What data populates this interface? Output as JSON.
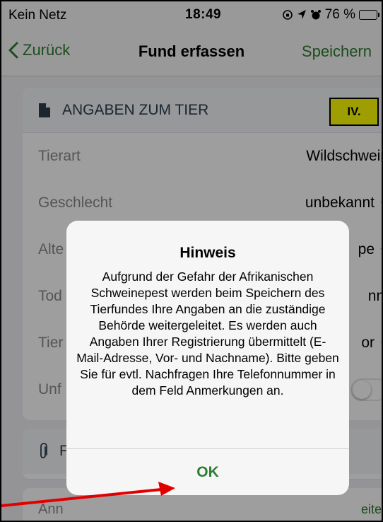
{
  "status_bar": {
    "carrier": "Kein Netz",
    "time": "18:49",
    "battery": "76 %",
    "icons": [
      "screen-rotation-lock-icon",
      "location-icon",
      "alarm-icon",
      "battery-icon"
    ]
  },
  "nav": {
    "back_label": "Zurück",
    "title": "Fund erfassen",
    "save_label": "Speichern"
  },
  "section_animal": {
    "title": "ANGABEN ZUM TIER",
    "badge": "IV.",
    "rows": [
      {
        "label": "Tierart",
        "value": "Wildschwein"
      },
      {
        "label": "Geschlecht",
        "value": "unbekannt"
      },
      {
        "label": "Alte",
        "value": "pe"
      },
      {
        "label": "Tod",
        "value": "nnt"
      },
      {
        "label": "Tier",
        "value": "or"
      },
      {
        "label": "Unf",
        "value": ""
      }
    ]
  },
  "section_files": {
    "title": "F"
  },
  "section_notes": {
    "label": "Ann",
    "link": "eiten"
  },
  "alert": {
    "title": "Hinweis",
    "message": "Aufgrund der Gefahr der Afrikanischen Schweinepest werden beim Speichern des Tierfundes Ihre Angaben an die zuständige Behörde weitergeleitet. Es werden auch Angaben Ihrer Registrierung übermittelt (E-Mail-Adresse, Vor- und Nachname). Bitte geben Sie für evtl. Nachfragen Ihre Telefonnummer in dem Feld Anmerkungen an.",
    "ok_label": "OK"
  },
  "colors": {
    "accent_green": "#2e7d32",
    "annotation_red": "#e00000",
    "badge_yellow": "#ffff00"
  }
}
